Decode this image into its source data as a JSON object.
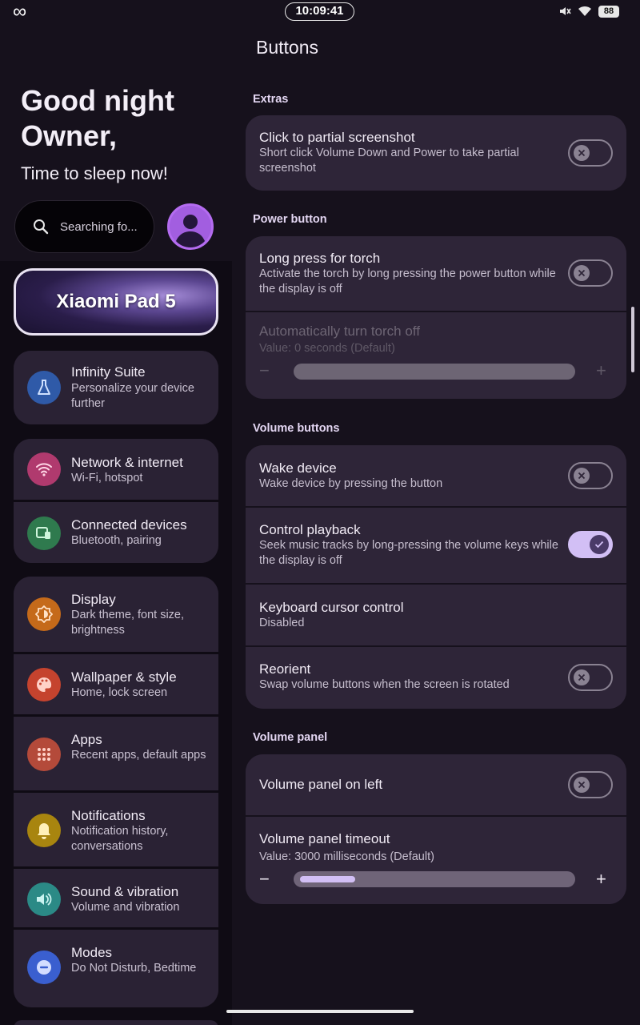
{
  "status_bar": {
    "left_icon": "infinity-icon",
    "time": "10:09:41",
    "battery": "88",
    "icons": [
      "mute-icon",
      "wifi-icon",
      "battery-icon"
    ]
  },
  "left": {
    "greeting_line1": "Good night",
    "greeting_line2": "Owner,",
    "greeting_line3": "Time to sleep now!",
    "search_placeholder": "Searching fo...",
    "device_name": "Xiaomi Pad 5",
    "nav": [
      {
        "title": "Infinity Suite",
        "subtitle": "Personalize your device further",
        "icon": "flask-icon",
        "color": "#2f5aa8"
      },
      {
        "title": "Network & internet",
        "subtitle": "Wi-Fi, hotspot",
        "icon": "wifi-icon",
        "color": "#b03a6e"
      },
      {
        "title": "Connected devices",
        "subtitle": "Bluetooth, pairing",
        "icon": "devices-icon",
        "color": "#2f7a4e"
      },
      {
        "title": "Display",
        "subtitle": "Dark theme, font size, brightness",
        "icon": "brightness-icon",
        "color": "#c56a1a"
      },
      {
        "title": "Wallpaper & style",
        "subtitle": "Home, lock screen",
        "icon": "palette-icon",
        "color": "#c5432e"
      },
      {
        "title": "Apps",
        "subtitle": "Recent apps, default apps",
        "icon": "apps-grid-icon",
        "color": "#b44a3a"
      },
      {
        "title": "Notifications",
        "subtitle": "Notification history, conversations",
        "icon": "bell-icon",
        "color": "#a8850f"
      },
      {
        "title": "Sound & vibration",
        "subtitle": "Volume and vibration",
        "icon": "speaker-icon",
        "color": "#2b8a86"
      },
      {
        "title": "Modes",
        "subtitle": "Do Not Disturb, Bedtime",
        "icon": "minus-circle-icon",
        "color": "#3a5fcf"
      }
    ]
  },
  "right": {
    "title": "Buttons",
    "sections": {
      "extras": "Extras",
      "power": "Power button",
      "volume": "Volume buttons",
      "panel": "Volume panel"
    },
    "items": {
      "partial_screenshot": {
        "title": "Click to partial screenshot",
        "subtitle": "Short click Volume Down and Power to take partial screenshot",
        "on": false
      },
      "torch": {
        "title": "Long press for torch",
        "subtitle": "Activate the torch by long pressing the power button while the display is off",
        "on": false
      },
      "torch_off": {
        "title": "Automatically turn torch off",
        "subtitle": "Value: 0 seconds (Default)",
        "enabled": false,
        "fraction": 0
      },
      "wake": {
        "title": "Wake device",
        "subtitle": "Wake device by pressing the button",
        "on": false
      },
      "playback": {
        "title": "Control playback",
        "subtitle": "Seek music tracks by long-pressing the volume keys while the display is off",
        "on": true
      },
      "cursor": {
        "title": "Keyboard cursor control",
        "subtitle": "Disabled"
      },
      "reorient": {
        "title": "Reorient",
        "subtitle": "Swap volume buttons when the screen is rotated",
        "on": false
      },
      "panel_left": {
        "title": "Volume panel on left",
        "on": false
      },
      "panel_timeout": {
        "title": "Volume panel timeout",
        "subtitle": "Value: 3000 milliseconds (Default)",
        "fraction": 0.22
      }
    },
    "slider_minus": "−",
    "slider_plus": "+"
  },
  "colors": {
    "accent": "#d2bff5",
    "card": "#2e2538",
    "background": "#16111c"
  }
}
